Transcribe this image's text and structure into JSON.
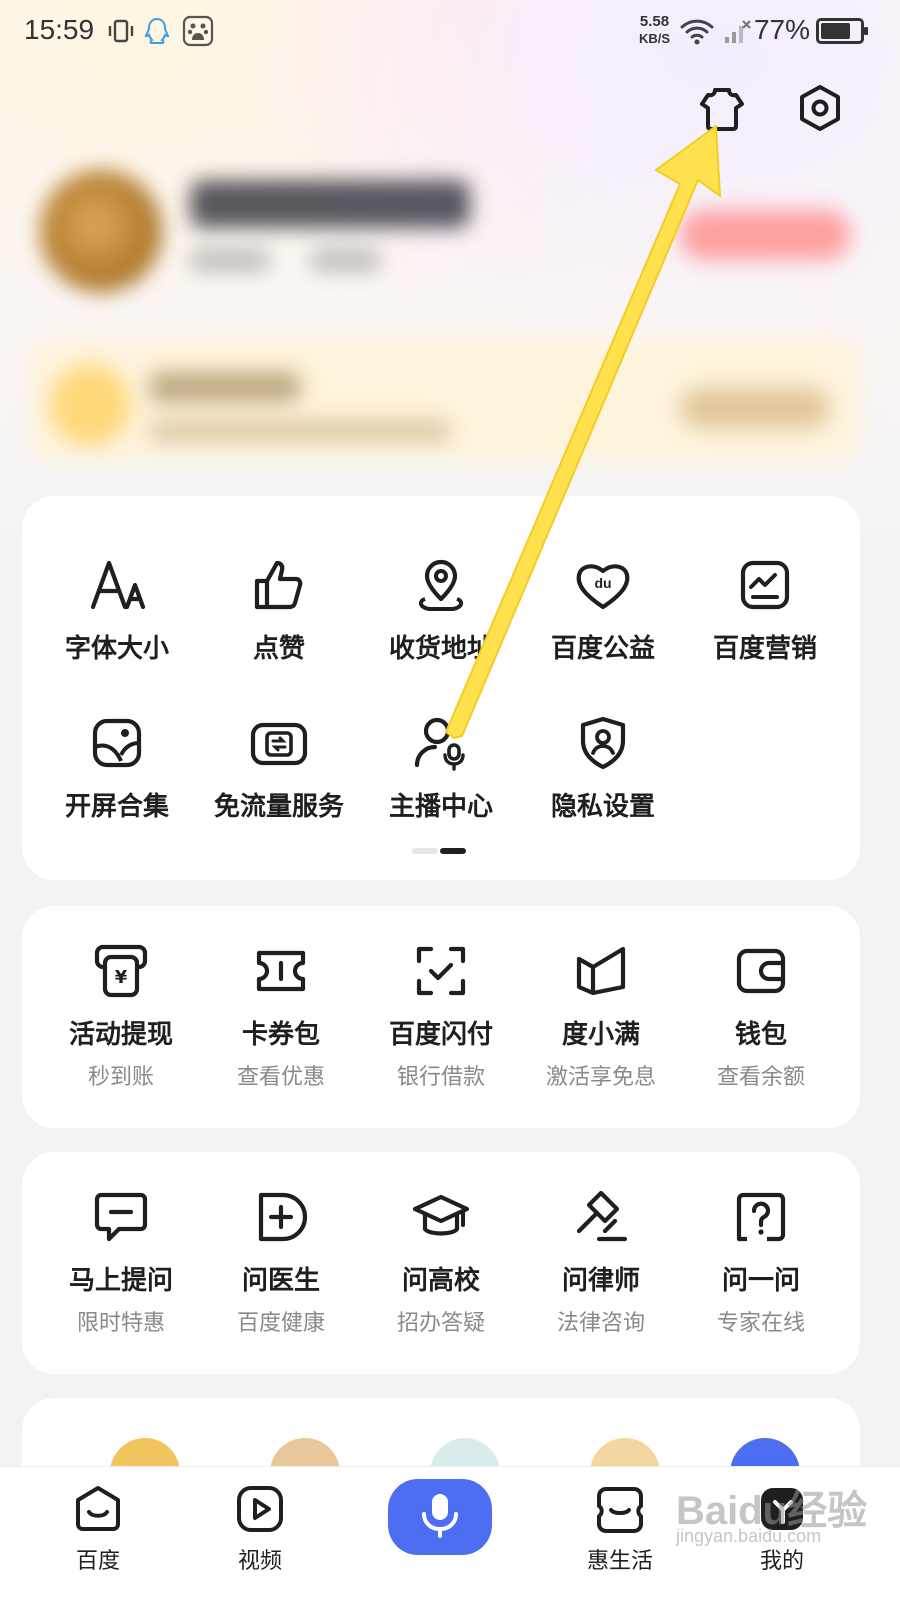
{
  "status_bar": {
    "time": "15:59",
    "net_speed_value": "5.58",
    "net_speed_unit": "KB/S",
    "battery_percent": "77%",
    "battery_level": 0.77
  },
  "header": {
    "icons": [
      "shirt-icon",
      "settings-icon"
    ]
  },
  "tools": {
    "items": [
      {
        "label": "字体大小",
        "icon": "font-size-icon"
      },
      {
        "label": "点赞",
        "icon": "thumbs-up-icon"
      },
      {
        "label": "收货地址",
        "icon": "location-pin-icon"
      },
      {
        "label": "百度公益",
        "icon": "charity-heart-icon"
      },
      {
        "label": "百度营销",
        "icon": "marketing-chart-icon"
      },
      {
        "label": "开屏合集",
        "icon": "splash-image-icon"
      },
      {
        "label": "免流量服务",
        "icon": "data-free-icon"
      },
      {
        "label": "主播中心",
        "icon": "anchor-mic-icon"
      },
      {
        "label": "隐私设置",
        "icon": "privacy-shield-icon"
      }
    ],
    "page_index": 2,
    "page_count": 2
  },
  "finance": {
    "items": [
      {
        "label": "活动提现",
        "sub": "秒到账",
        "icon": "withdraw-icon"
      },
      {
        "label": "卡券包",
        "sub": "查看优惠",
        "icon": "coupon-icon"
      },
      {
        "label": "百度闪付",
        "sub": "银行借款",
        "icon": "quick-pay-icon"
      },
      {
        "label": "度小满",
        "sub": "激活享免息",
        "icon": "duxiaoman-icon"
      },
      {
        "label": "钱包",
        "sub": "查看余额",
        "icon": "wallet-icon"
      }
    ]
  },
  "consult": {
    "items": [
      {
        "label": "马上提问",
        "sub": "限时特惠",
        "icon": "ask-chat-icon"
      },
      {
        "label": "问医生",
        "sub": "百度健康",
        "icon": "doctor-plus-icon"
      },
      {
        "label": "问高校",
        "sub": "招办答疑",
        "icon": "graduation-cap-icon"
      },
      {
        "label": "问律师",
        "sub": "法律咨询",
        "icon": "gavel-icon"
      },
      {
        "label": "问一问",
        "sub": "专家在线",
        "icon": "question-icon"
      }
    ]
  },
  "bottom_nav": {
    "items": [
      {
        "label": "百度",
        "icon": "baidu-home-icon"
      },
      {
        "label": "视频",
        "icon": "video-play-icon"
      },
      {
        "label": "",
        "icon": "microphone-icon"
      },
      {
        "label": "惠生活",
        "icon": "life-icon"
      },
      {
        "label": "我的",
        "icon": "profile-icon"
      }
    ]
  },
  "watermark": {
    "brand": "Baidu经验",
    "url": "jingyan.baidu.com"
  },
  "colors": {
    "accent": "#4e6ef2",
    "arrow": "#ffe14d",
    "text_primary": "#1f1f1f",
    "text_secondary": "#8a8a8a"
  }
}
